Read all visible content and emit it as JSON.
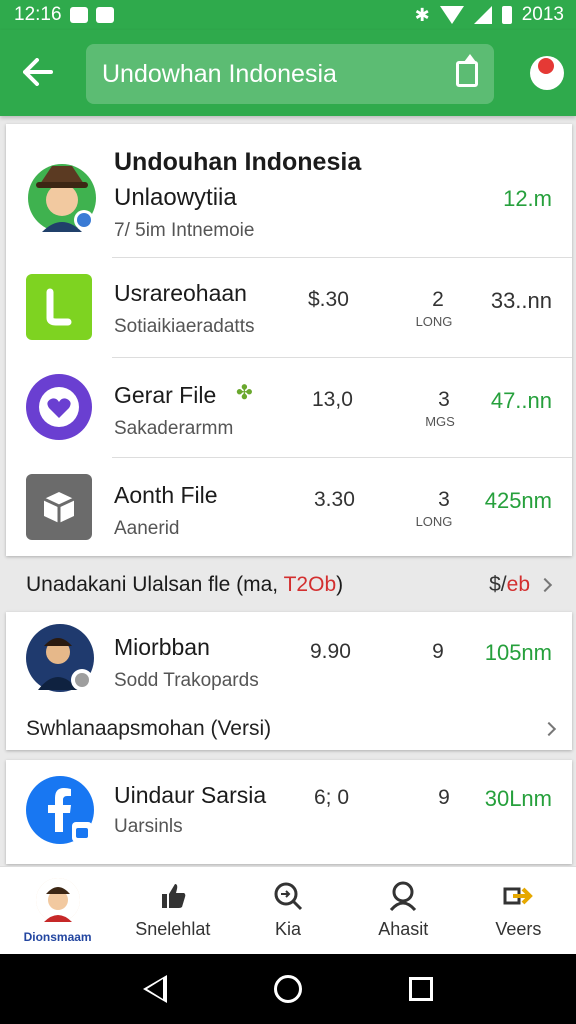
{
  "status": {
    "time": "12:16",
    "year": "2013"
  },
  "appbar": {
    "search_value": "Undowhan Indonesia"
  },
  "featured": {
    "title": "Undouhan Indonesia",
    "subtitle": "Unlaowytiia",
    "meta": "7/ 5im  Intnemoie",
    "size": "12.m"
  },
  "apps": [
    {
      "title": "Usrareohaan",
      "sub": "Sotiaikiaeradatts",
      "price": "$.30",
      "count": "2",
      "unit": "LONG",
      "size": "33..nn"
    },
    {
      "title": "Gerar File",
      "sub": "Sakaderarmm",
      "price": "13,0",
      "count": "3",
      "unit": "MGS",
      "size": "47..nn"
    },
    {
      "title": "Aonth File",
      "sub": "Aanerid",
      "price": "3.30",
      "count": "3",
      "unit": "LONG",
      "size": "425nm"
    }
  ],
  "section": {
    "label": "Unadakani Ulalsan fle",
    "paren_open": "(ma, ",
    "paren_red": "T2Ob",
    "paren_close": ")",
    "link_prefix": "$/",
    "link_red": "eb"
  },
  "card2": {
    "title": "Miorbban",
    "sub": "Sodd Trakopards",
    "price": "9.90",
    "count": "9",
    "size": "105nm",
    "version": "Swhlanaapsmohan (Versi)"
  },
  "card3": {
    "title": "Uindaur Sarsia",
    "sub": "Uarsinls",
    "price": "6; 0",
    "count": "9",
    "size": "30Lnm"
  },
  "nav": [
    {
      "label": "Dionsmaam",
      "icon": "avatar-icon"
    },
    {
      "label": "Snelehlat",
      "icon": "thumbs-up-icon"
    },
    {
      "label": "Kia",
      "icon": "search-icon"
    },
    {
      "label": "Ahasit",
      "icon": "person-icon"
    },
    {
      "label": "Veers",
      "icon": "arrow-right-icon"
    }
  ],
  "colors": {
    "green": "#2faa4c",
    "size_green": "#26a03c",
    "red": "#d32f2f"
  }
}
